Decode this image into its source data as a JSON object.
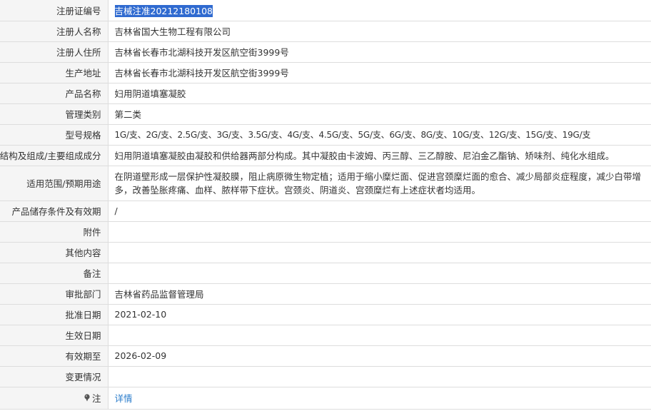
{
  "rows": [
    {
      "label": "注册证编号",
      "value": "吉械注准20212180108"
    },
    {
      "label": "注册人名称",
      "value": "吉林省国大生物工程有限公司"
    },
    {
      "label": "注册人住所",
      "value": "吉林省长春市北湖科技开发区航空街3999号"
    },
    {
      "label": "生产地址",
      "value": "吉林省长春市北湖科技开发区航空街3999号"
    },
    {
      "label": "产品名称",
      "value": "妇用阴道填塞凝胶"
    },
    {
      "label": "管理类别",
      "value": "第二类"
    },
    {
      "label": "型号规格",
      "value": "1G/支、2G/支、2.5G/支、3G/支、3.5G/支、4G/支、4.5G/支、5G/支、6G/支、8G/支、10G/支、12G/支、15G/支、19G/支"
    },
    {
      "label": "结构及组成/主要组成成分",
      "value": "妇用阴道填塞凝胶由凝胶和供给器两部分构成。其中凝胶由卡波姆、丙三醇、三乙醇胺、尼泊金乙酯钠、矫味剂、纯化水组成。"
    },
    {
      "label": "适用范围/预期用途",
      "value": "在阴道壁形成一层保护性凝胶膜，阻止病原微生物定植；适用于缩小糜烂面、促进宫颈糜烂面的愈合、减少局部炎症程度，减少白带增多，改善坠胀疼痛、血样、脓样带下症状。宫颈炎、阴道炎、宫颈糜烂有上述症状者均适用。"
    },
    {
      "label": "产品储存条件及有效期",
      "value": "/"
    },
    {
      "label": "附件",
      "value": ""
    },
    {
      "label": "其他内容",
      "value": ""
    },
    {
      "label": "备注",
      "value": ""
    },
    {
      "label": "审批部门",
      "value": "吉林省药品监督管理局"
    },
    {
      "label": "批准日期",
      "value": "2021-02-10"
    },
    {
      "label": "生效日期",
      "value": ""
    },
    {
      "label": "有效期至",
      "value": "2026-02-09"
    },
    {
      "label": "变更情况",
      "value": ""
    }
  ],
  "note": {
    "label": "注",
    "link_text": "详情",
    "icon": "pin-icon"
  },
  "colors": {
    "highlight": "#2f6ad0",
    "link": "#2a7ccb",
    "label_bg": "#f5f5f5",
    "border": "#dddddd"
  }
}
